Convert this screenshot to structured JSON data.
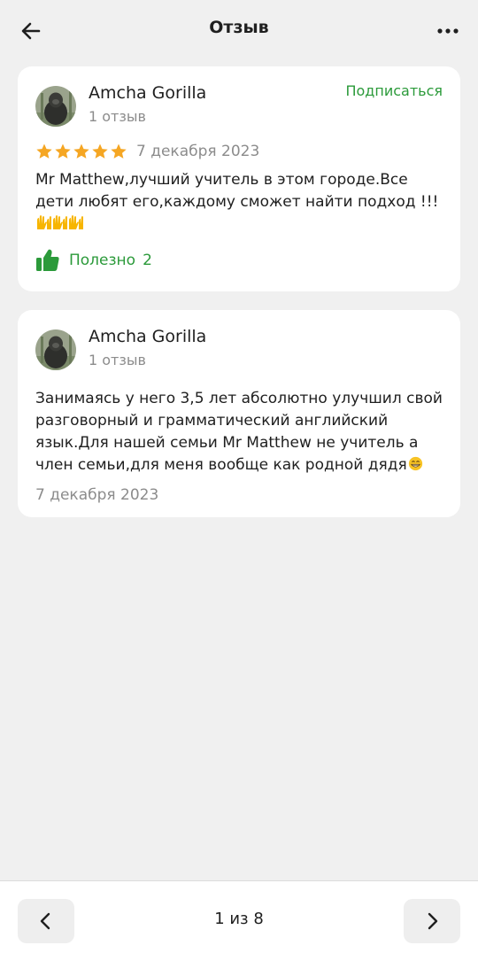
{
  "header": {
    "title": "Отзыв",
    "back_icon": "arrow-left-icon",
    "more_icon": "more-horizontal-icon"
  },
  "reviews": [
    {
      "author": "Amcha Gorilla",
      "author_reviews": "1 отзыв",
      "subscribe_label": "Подписаться",
      "rating": 5,
      "date": "7 декабря 2023",
      "text": "Mr Matthew,лучший учитель в этом городе.Все дети любят его,каждому сможет найти подход !!!",
      "text_emoji": "🙌🙌🙌",
      "helpful_label": "Полезно",
      "helpful_count": "2"
    },
    {
      "author": "Amcha Gorilla",
      "author_reviews": "1 отзыв",
      "text": "Занимаясь у него 3,5 лет абсолютно улучшил свой разговорный и грамматический английский язык.Для нашей семьи Mr Matthew не учитель а член семьи,для меня вообще как родной дядя",
      "text_emoji": "😁",
      "date": "7 декабря 2023"
    }
  ],
  "pagination": {
    "text": "1 из 8",
    "prev_icon": "chevron-left-icon",
    "next_icon": "chevron-right-icon"
  },
  "colors": {
    "accent": "#2b9a3a",
    "star": "#f5a623",
    "background": "#f0f0f0",
    "card": "#ffffff",
    "muted_text": "#8c8c8c"
  }
}
